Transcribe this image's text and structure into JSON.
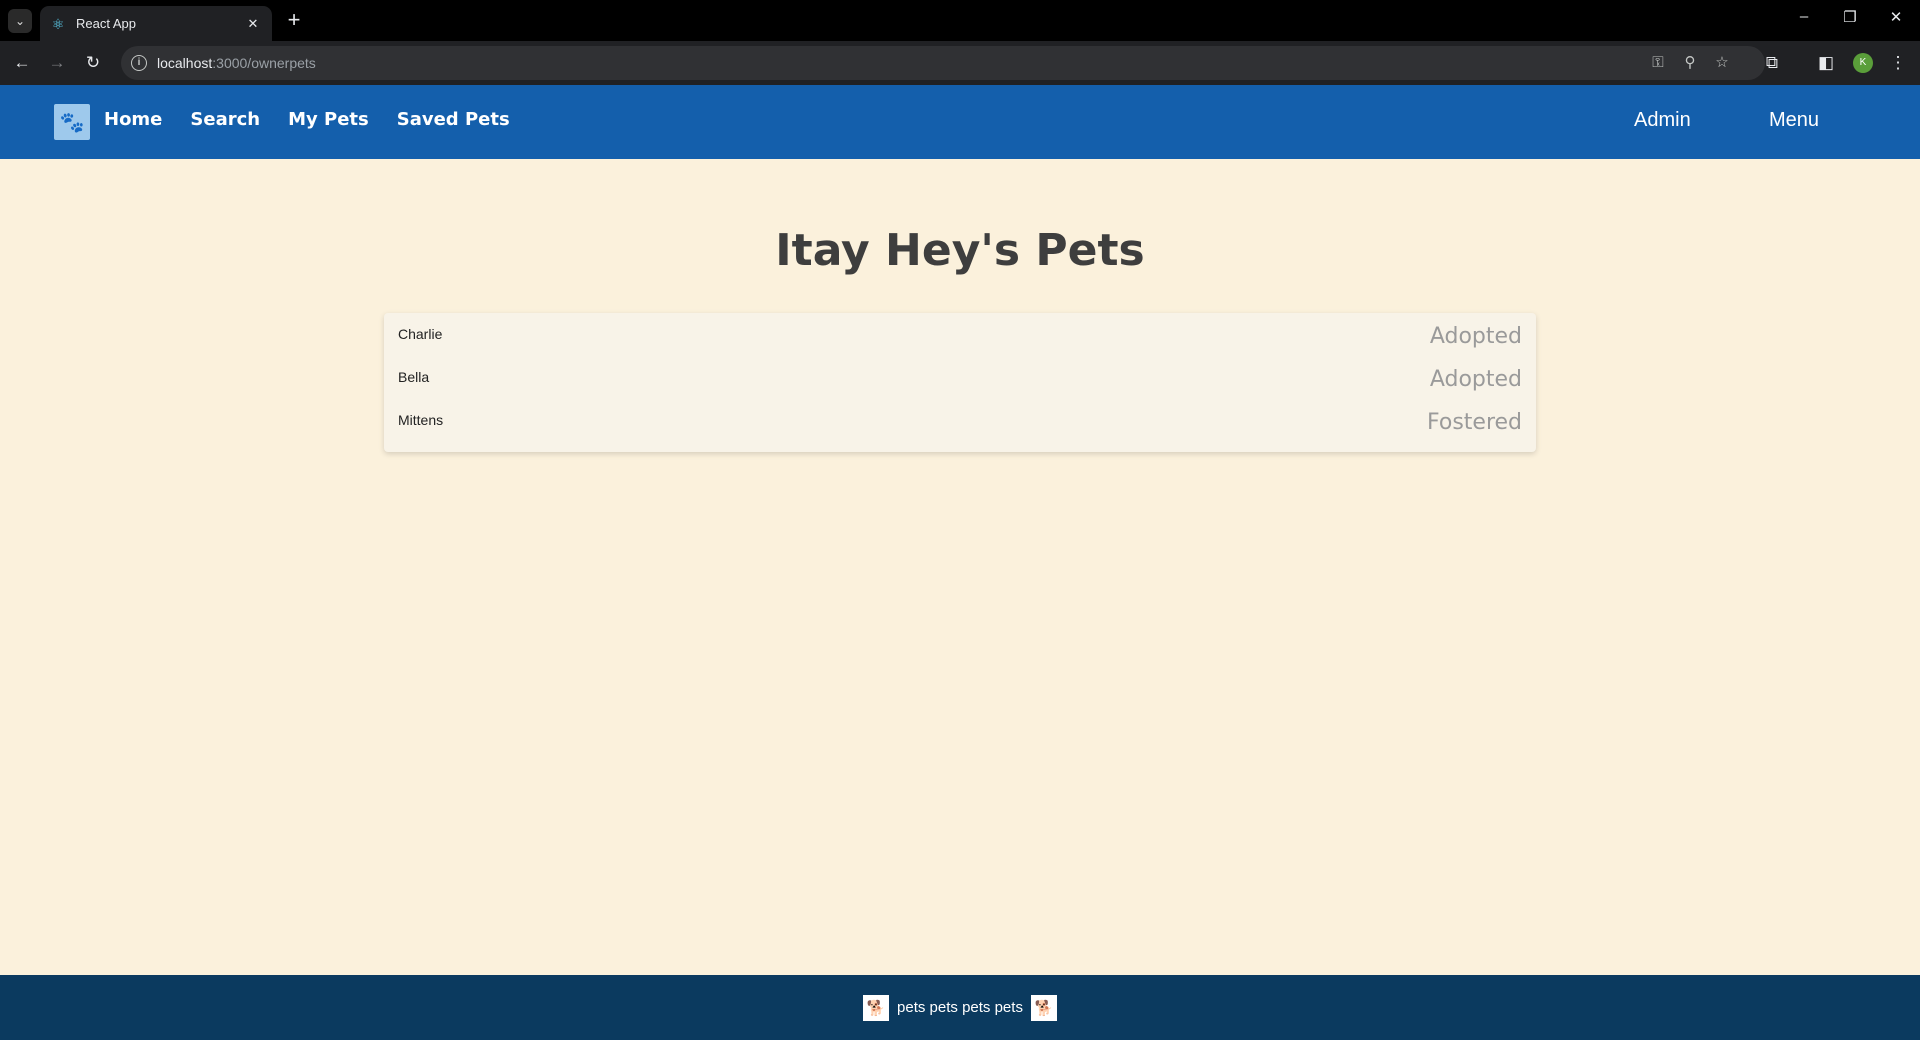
{
  "browser": {
    "tab_title": "React App",
    "url_host": "localhost",
    "url_path": ":3000/ownerpets",
    "avatar_letter": "K"
  },
  "nav": {
    "links": [
      "Home",
      "Search",
      "My Pets",
      "Saved Pets"
    ],
    "admin": "Admin",
    "menu": "Menu"
  },
  "page": {
    "title": "Itay Hey's Pets"
  },
  "pets": [
    {
      "name": "Charlie",
      "status": "Adopted"
    },
    {
      "name": "Bella",
      "status": "Adopted"
    },
    {
      "name": "Mittens",
      "status": "Fostered"
    }
  ],
  "footer": {
    "text": "pets pets pets pets"
  },
  "colors": {
    "nav_bg": "#145fac",
    "page_bg": "#fbf1dc",
    "footer_bg": "#0b3a5f"
  }
}
